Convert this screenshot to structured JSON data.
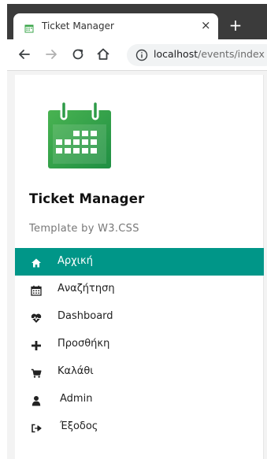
{
  "browser": {
    "tab_title": "Ticket Manager",
    "close_glyph": "×",
    "newtab_glyph": "+",
    "url_host": "localhost",
    "url_path": "/events/index"
  },
  "sidebar": {
    "title": "Ticket Manager",
    "subtitle": "Template by W3.CSS",
    "accent_color": "#009688",
    "logo_color": "#3aa64a",
    "items": [
      {
        "label": "Αρχική",
        "icon": "home-icon",
        "active": true
      },
      {
        "label": "Αναζήτηση",
        "icon": "calendar-icon",
        "active": false
      },
      {
        "label": "Dashboard",
        "icon": "heartbeat-icon",
        "active": false
      },
      {
        "label": "Προσθήκη",
        "icon": "plus-icon",
        "active": false
      },
      {
        "label": "Καλάθι",
        "icon": "cart-icon",
        "active": false
      },
      {
        "label": "Admin",
        "icon": "user-icon",
        "active": false
      },
      {
        "label": "Έξοδος",
        "icon": "sign-out-icon",
        "active": false
      }
    ]
  }
}
